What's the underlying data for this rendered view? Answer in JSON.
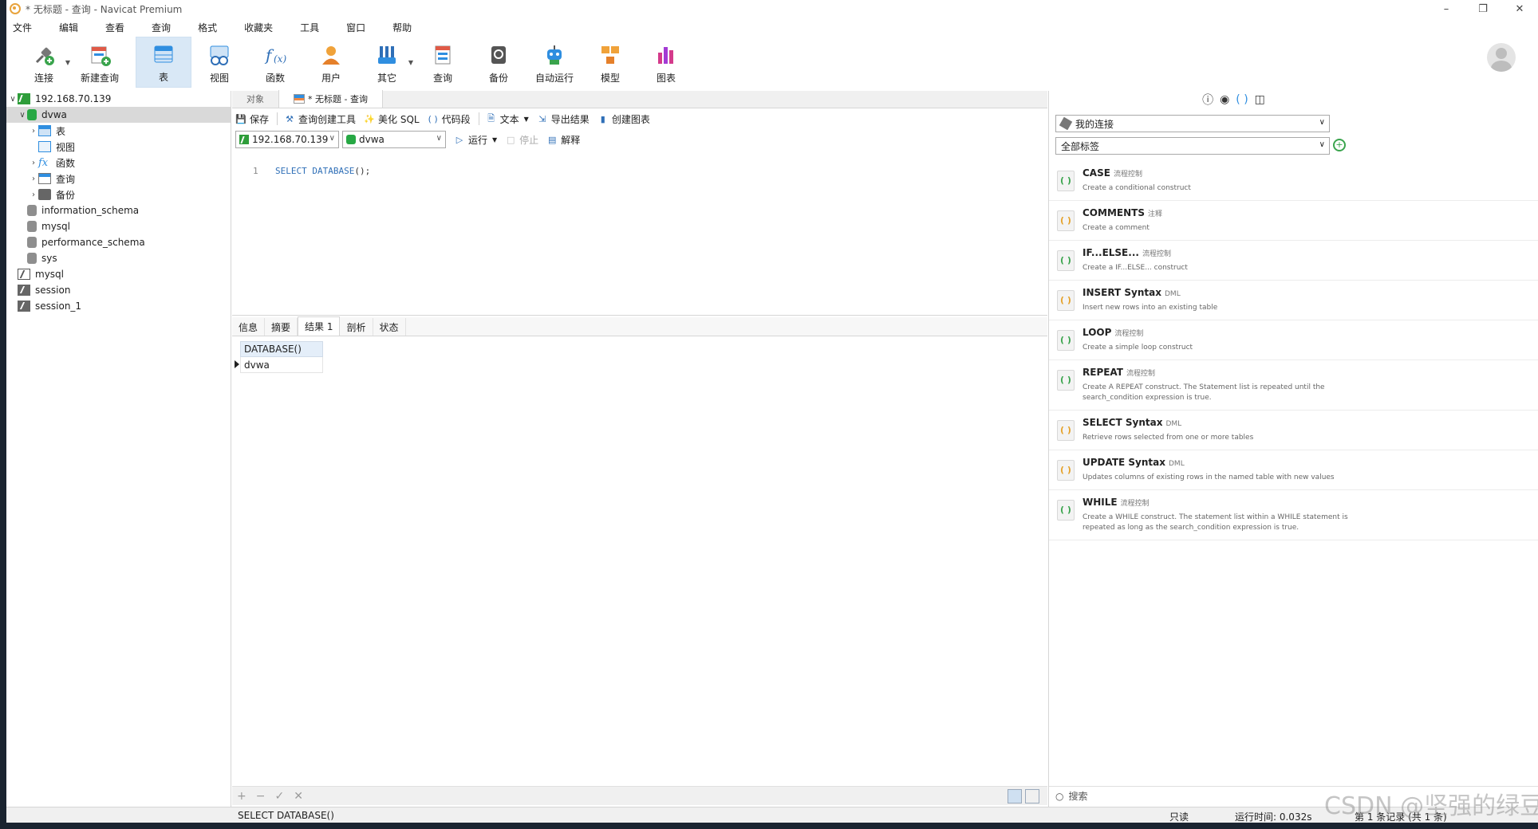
{
  "window": {
    "title": "* 无标题 - 查询 - Navicat Premium"
  },
  "menu": [
    "文件",
    "编辑",
    "查看",
    "查询",
    "格式",
    "收藏夹",
    "工具",
    "窗口",
    "帮助"
  ],
  "toolbar": {
    "connect": "连接",
    "new_query": "新建查询",
    "table": "表",
    "view": "视图",
    "function": "函数",
    "user": "用户",
    "other": "其它",
    "query": "查询",
    "backup": "备份",
    "automation": "自动运行",
    "model": "模型",
    "chart": "图表"
  },
  "tree": {
    "connection": "192.168.70.139",
    "db_selected": "dvwa",
    "children": [
      "表",
      "视图",
      "函数",
      "查询",
      "备份"
    ],
    "other_dbs": [
      "information_schema",
      "mysql",
      "performance_schema",
      "sys"
    ],
    "other_conns": [
      "mysql",
      "session",
      "session_1"
    ]
  },
  "tabs": {
    "objects": "对象",
    "query": "* 无标题 - 查询"
  },
  "query_toolbar": {
    "save": "保存",
    "builder": "查询创建工具",
    "beautify": "美化 SQL",
    "snippet": "代码段",
    "text": "文本",
    "export": "导出结果",
    "create_chart": "创建图表"
  },
  "selectors": {
    "connection": "192.168.70.139",
    "database": "dvwa",
    "run": "运行",
    "stop": "停止",
    "explain": "解释"
  },
  "editor": {
    "line": "1",
    "keyword": "SELECT DATABASE",
    "rest": "();"
  },
  "result_tabs": [
    "信息",
    "摘要",
    "结果 1",
    "剖析",
    "状态"
  ],
  "result": {
    "column": "DATABASE()",
    "value": "dvwa"
  },
  "right_panel": {
    "connection_combo": "我的连接",
    "tag_combo": "全部标签",
    "search_placeholder": "搜索",
    "snippets": [
      {
        "name": "CASE",
        "tag": "流程控制",
        "desc": "Create a conditional construct"
      },
      {
        "name": "COMMENTS",
        "tag": "注释",
        "desc": "Create a comment"
      },
      {
        "name": "IF...ELSE...",
        "tag": "流程控制",
        "desc": "Create a IF...ELSE... construct"
      },
      {
        "name": "INSERT Syntax",
        "tag": "DML",
        "desc": "Insert new rows into an existing table"
      },
      {
        "name": "LOOP",
        "tag": "流程控制",
        "desc": "Create a simple loop construct"
      },
      {
        "name": "REPEAT",
        "tag": "流程控制",
        "desc": "Create A REPEAT construct. The Statement list is repeated until the search_condition expression is true."
      },
      {
        "name": "SELECT Syntax",
        "tag": "DML",
        "desc": "Retrieve rows selected from one or more tables"
      },
      {
        "name": "UPDATE Syntax",
        "tag": "DML",
        "desc": "Updates columns of existing rows in the named table with new values"
      },
      {
        "name": "WHILE",
        "tag": "流程控制",
        "desc": "Create a WHILE construct. The statement list within a WHILE statement is repeated as long as the search_condition expression is true."
      }
    ]
  },
  "status": {
    "sql": "SELECT DATABASE()",
    "readonly": "只读",
    "runtime": "运行时间: 0.032s",
    "records": "第 1 条记录 (共 1 条)"
  },
  "watermark": "CSDN @坚强的绿豆饼",
  "colors": {
    "accent": "#2f8ee0",
    "selected_tab": "#d9e8f6",
    "db_green": "#27a844"
  }
}
